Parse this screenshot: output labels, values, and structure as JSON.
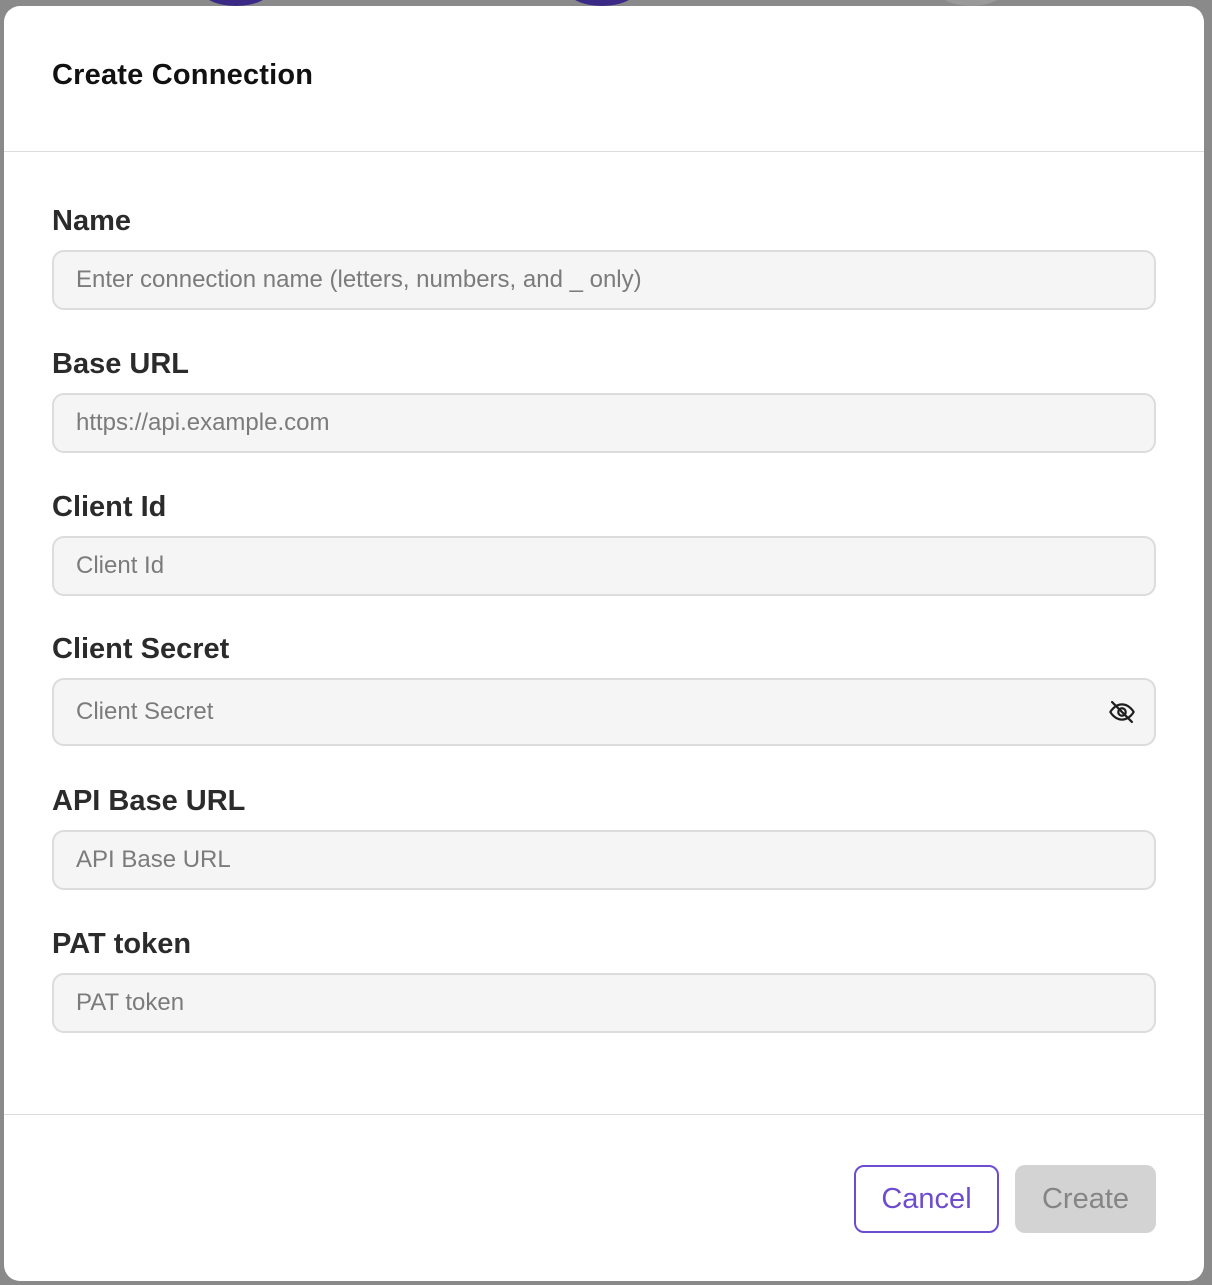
{
  "dialog": {
    "title": "Create Connection"
  },
  "fields": {
    "name": {
      "label": "Name",
      "value": "",
      "placeholder": "Enter connection name (letters, numbers, and _ only)"
    },
    "base_url": {
      "label": "Base URL",
      "value": "",
      "placeholder": "https://api.example.com"
    },
    "client_id": {
      "label": "Client Id",
      "value": "",
      "placeholder": "Client Id"
    },
    "client_secret": {
      "label": "Client Secret",
      "value": "",
      "placeholder": "Client Secret",
      "toggle_icon": "eye-off-icon"
    },
    "api_base_url": {
      "label": "API Base URL",
      "value": "",
      "placeholder": "API Base URL"
    },
    "pat_token": {
      "label": "PAT token",
      "value": "",
      "placeholder": "PAT token"
    }
  },
  "footer": {
    "cancel_label": "Cancel",
    "create_label": "Create",
    "create_disabled": true
  },
  "colors": {
    "accent": "#6e4ccf",
    "disabled_bg": "#d3d3d3",
    "disabled_text": "#858585",
    "input_bg": "#f5f5f5",
    "input_border": "#dcdcdc"
  }
}
